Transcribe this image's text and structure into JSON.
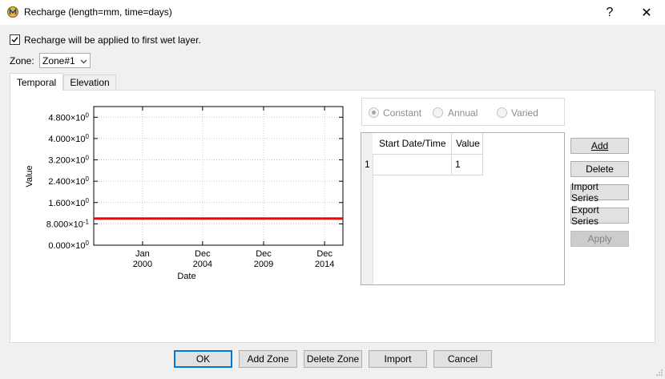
{
  "window": {
    "title": "Recharge (length=mm, time=days)",
    "help_glyph": "?",
    "close_glyph": "✕"
  },
  "options": {
    "apply_first_wet_layer_label": "Recharge will be applied to first wet layer.",
    "apply_first_wet_layer_checked": true,
    "zone_label": "Zone:",
    "zone_value": "Zone#1"
  },
  "tabs": [
    {
      "label": "Temporal",
      "active": true
    },
    {
      "label": "Elevation",
      "active": false
    }
  ],
  "mode": {
    "constant_label": "Constant",
    "annual_label": "Annual",
    "varied_label": "Varied",
    "selected": "Constant"
  },
  "table": {
    "columns": [
      "Start Date/Time",
      "Value"
    ],
    "rows": [
      {
        "index": "1",
        "start": "",
        "value": "1"
      }
    ]
  },
  "side_buttons": {
    "add": "Add",
    "delete": "Delete",
    "import_series": "Import Series",
    "export_series": "Export Series",
    "apply": "Apply"
  },
  "footer_buttons": {
    "ok": "OK",
    "add_zone": "Add Zone",
    "delete_zone": "Delete Zone",
    "import": "Import",
    "cancel": "Cancel"
  },
  "chart_data": {
    "type": "line",
    "xlabel": "Date",
    "ylabel": "Value",
    "ylim": [
      0,
      5.2
    ],
    "y_ticks": [
      {
        "value": 0,
        "mant": "0.000",
        "exp": "0"
      },
      {
        "value": 0.8,
        "mant": "8.000",
        "exp": "-1"
      },
      {
        "value": 1.6,
        "mant": "1.600",
        "exp": "0"
      },
      {
        "value": 2.4,
        "mant": "2.400",
        "exp": "0"
      },
      {
        "value": 3.2,
        "mant": "3.200",
        "exp": "0"
      },
      {
        "value": 4.0,
        "mant": "4.000",
        "exp": "0"
      },
      {
        "value": 4.8,
        "mant": "4.800",
        "exp": "0"
      }
    ],
    "xlim": [
      "1996-01",
      "2016-06"
    ],
    "x_ticks": [
      {
        "date": "2000-01",
        "line1": "Jan",
        "line2": "2000"
      },
      {
        "date": "2004-12",
        "line1": "Dec",
        "line2": "2004"
      },
      {
        "date": "2009-12",
        "line1": "Dec",
        "line2": "2009"
      },
      {
        "date": "2014-12",
        "line1": "Dec",
        "line2": "2014"
      }
    ],
    "series": [
      {
        "color": "#ff0000",
        "points": [
          {
            "x": "1996-01",
            "y": 1
          },
          {
            "x": "2016-06",
            "y": 1
          }
        ]
      }
    ],
    "grid": true
  },
  "colors": {
    "series": "#ff0000",
    "default_button_border": "#0078d7"
  }
}
